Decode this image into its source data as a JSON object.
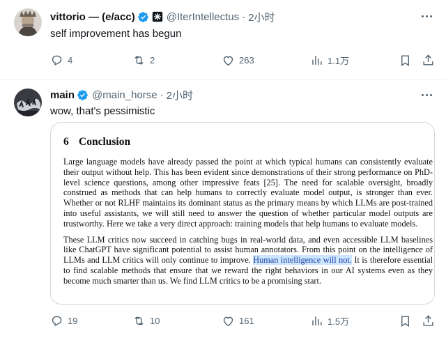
{
  "tweets": [
    {
      "name": "vittorio — (e/acc)",
      "handle": "@IterIntellectus",
      "separator": "·",
      "time": "2小时",
      "text": "self improvement has begun",
      "stats": {
        "replies": "4",
        "retweets": "2",
        "likes": "263",
        "views": "1.1万"
      }
    },
    {
      "name": "main",
      "handle": "@main_horse",
      "separator": "·",
      "time": "2小时",
      "text": "wow, that's pessimistic",
      "stats": {
        "replies": "19",
        "retweets": "10",
        "likes": "161",
        "views": "1.5万"
      },
      "attachment": {
        "section_number": "6",
        "section_title": "Conclusion",
        "paragraph1": "Large language models have already passed the point at which typical humans can consistently evaluate their output without help. This has been evident since demonstrations of their strong performance on PhD-level science questions, among other impressive feats [25]. The need for scalable oversight, broadly construed as methods that can help humans to correctly evaluate model output, is stronger than ever. Whether or not RLHF maintains its dominant status as the primary means by which LLMs are post-trained into useful assistants, we will still need to answer the question of whether particular model outputs are trustworthy. Here we take a very direct approach: training models that help humans to evaluate models.",
        "paragraph2_before": "These LLM critics now succeed in catching bugs in real-world data, and even accessible LLM baselines like ChatGPT have significant potential to assist human annotators. From this point on the intelligence of LLMs and LLM critics will only continue to improve. ",
        "paragraph2_highlight": "Human intelligence will not.",
        "paragraph2_after": " It is therefore essential to find scalable methods that ensure that we reward the right behaviors in our AI systems even as they become much smarter than us. We find LLM critics to be a promising start."
      }
    }
  ],
  "colors": {
    "text": "#0f1419",
    "muted": "#536471",
    "verified": "#1d9bf0",
    "highlight": "#cce6ff",
    "border": "#cfd9de"
  },
  "icons": [
    "reply-icon",
    "retweet-icon",
    "like-icon",
    "views-icon",
    "bookmark-icon",
    "share-icon",
    "verified-badge-icon",
    "more-icon"
  ]
}
